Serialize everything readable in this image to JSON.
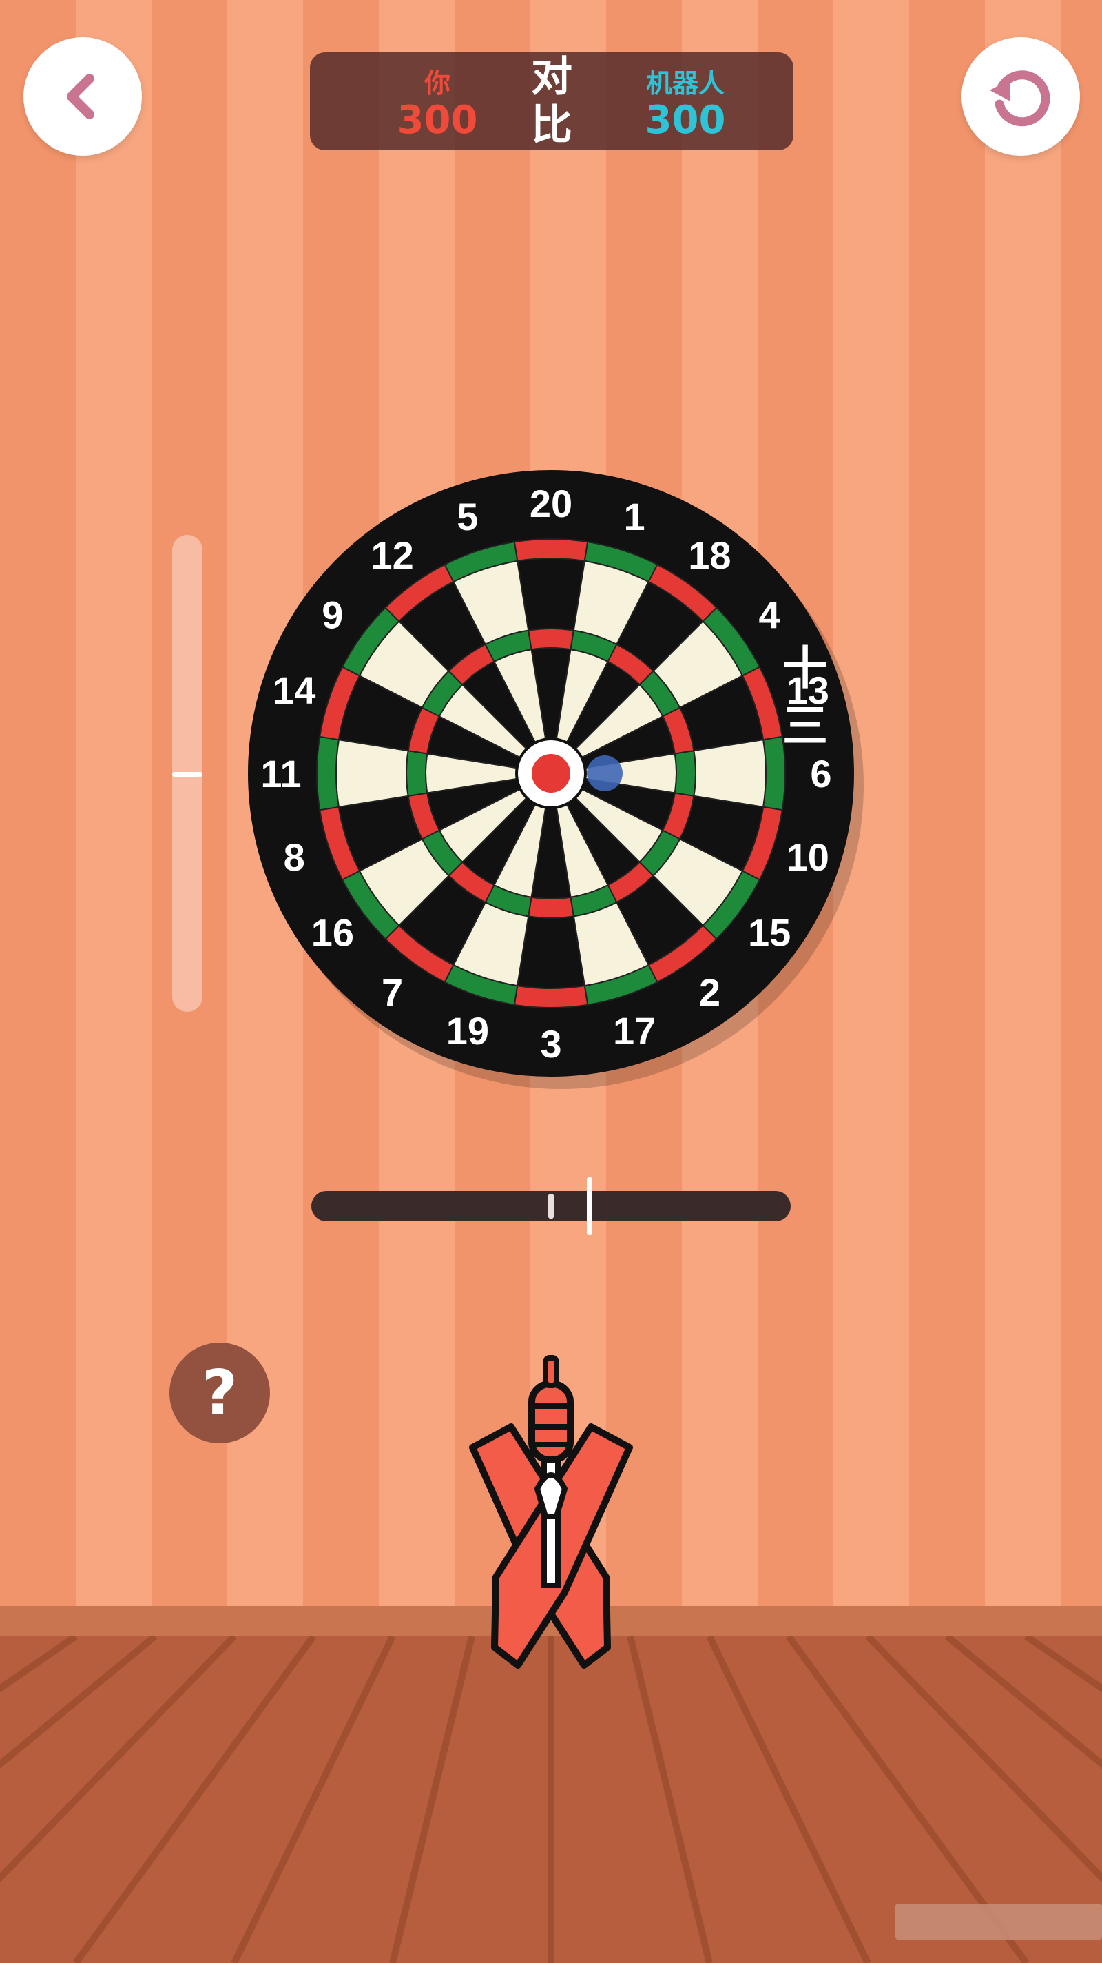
{
  "scoreboard": {
    "player_label": "你",
    "player_score": "300",
    "vs_top": "对",
    "vs_bottom": "比",
    "robot_label": "机器人",
    "robot_score": "300"
  },
  "dartboard": {
    "numbers": [
      "20",
      "1",
      "18",
      "4",
      "13",
      "6",
      "10",
      "15",
      "2",
      "17",
      "3",
      "19",
      "7",
      "16",
      "8",
      "11",
      "14",
      "9",
      "12",
      "5"
    ],
    "side_text": [
      "十",
      "三"
    ]
  },
  "help_button": {
    "label": "?"
  },
  "icons": {
    "back": "chevron-left-icon",
    "restart": "restart-icon",
    "dart": "dart-icon"
  },
  "colors": {
    "player": "#ef4a3a",
    "robot": "#2fc3d8",
    "accent_pink": "#c97592",
    "board_red": "#e53935",
    "board_green": "#1e8b3a",
    "board_black": "#111111",
    "board_cream": "#f7f2dc"
  }
}
